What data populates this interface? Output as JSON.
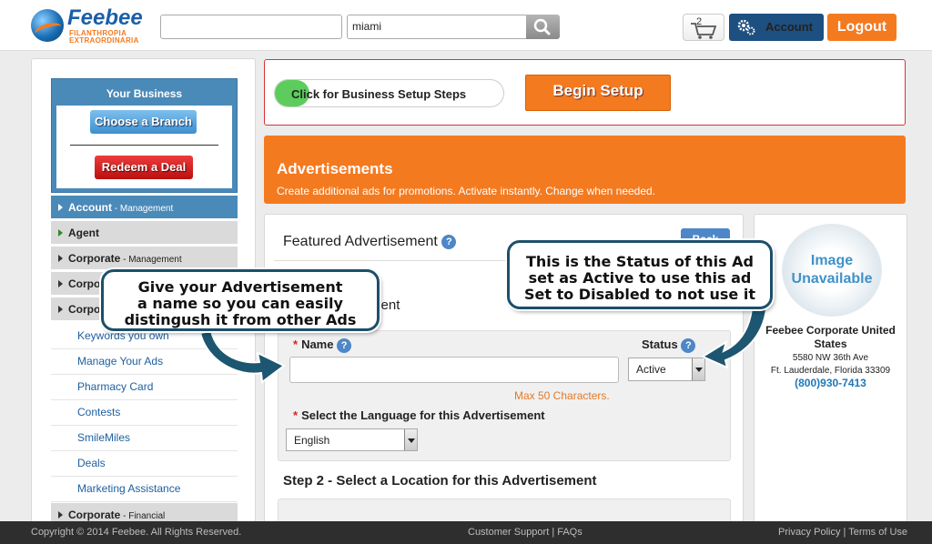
{
  "header": {
    "logo_name": "Feebee",
    "logo_tagline": "FILANTHROPIA EXTRAORDINARIA",
    "search_location_value": "miami",
    "cart_count": "2",
    "account_label": "Account",
    "logout_label": "Logout"
  },
  "sidebar": {
    "business_title": "Your Business",
    "choose_branch_label": "Choose a Branch",
    "redeem_deal_label": "Redeem a Deal",
    "nav": [
      {
        "label": "Account",
        "sub": " - Management"
      },
      {
        "label": "Agent",
        "sub": ""
      },
      {
        "label": "Corporate",
        "sub": " - Management"
      },
      {
        "label": "Corpor",
        "sub": ""
      },
      {
        "label": "Corpor",
        "sub": ""
      },
      {
        "label": "Corporate",
        "sub": " - Financial"
      }
    ],
    "sub_items": [
      "Keywords you own",
      "Manage Your Ads",
      "Pharmacy Card",
      "Contests",
      "SmileMiles",
      "Deals",
      "Marketing Assistance"
    ]
  },
  "setup": {
    "toggle_label": "Click for Business Setup Steps",
    "begin_label": "Begin Setup"
  },
  "banner": {
    "title": "Advertisements",
    "subtitle": "Create additional ads for promotions. Activate instantly. Change when needed."
  },
  "form": {
    "featured_title": "Featured Advertisement",
    "back_label": "Back",
    "step1_fragment": "your Advertisement",
    "name_label": "Name",
    "status_label": "Status",
    "status_value": "Active",
    "max_chars": "Max 50 Characters.",
    "language_label": "Select the Language for this Advertisement",
    "language_value": "English",
    "step2_label": "Step 2 - Select a Location for this Advertisement"
  },
  "corp": {
    "image_text_1": "Image",
    "image_text_2": "Unavailable",
    "name": "Feebee Corporate United States",
    "address_1": "5580 NW 36th Ave",
    "address_2": "Ft. Lauderdale, Florida 33309",
    "phone": "(800)930-7413"
  },
  "callouts": {
    "name_tip_1": "Give your Advertisement",
    "name_tip_2": "a name so you can easily",
    "name_tip_3": "distingush it from other Ads",
    "status_tip_1": "This is the Status of this Ad",
    "status_tip_2": "set as Active to use this ad",
    "status_tip_3": "Set to Disabled to not use it"
  },
  "footer": {
    "copyright": "Copyright © 2014 Feebee. All Rights Reserved.",
    "middle": "Customer Support | FAQs",
    "right": "Privacy Policy | Terms of Use"
  }
}
